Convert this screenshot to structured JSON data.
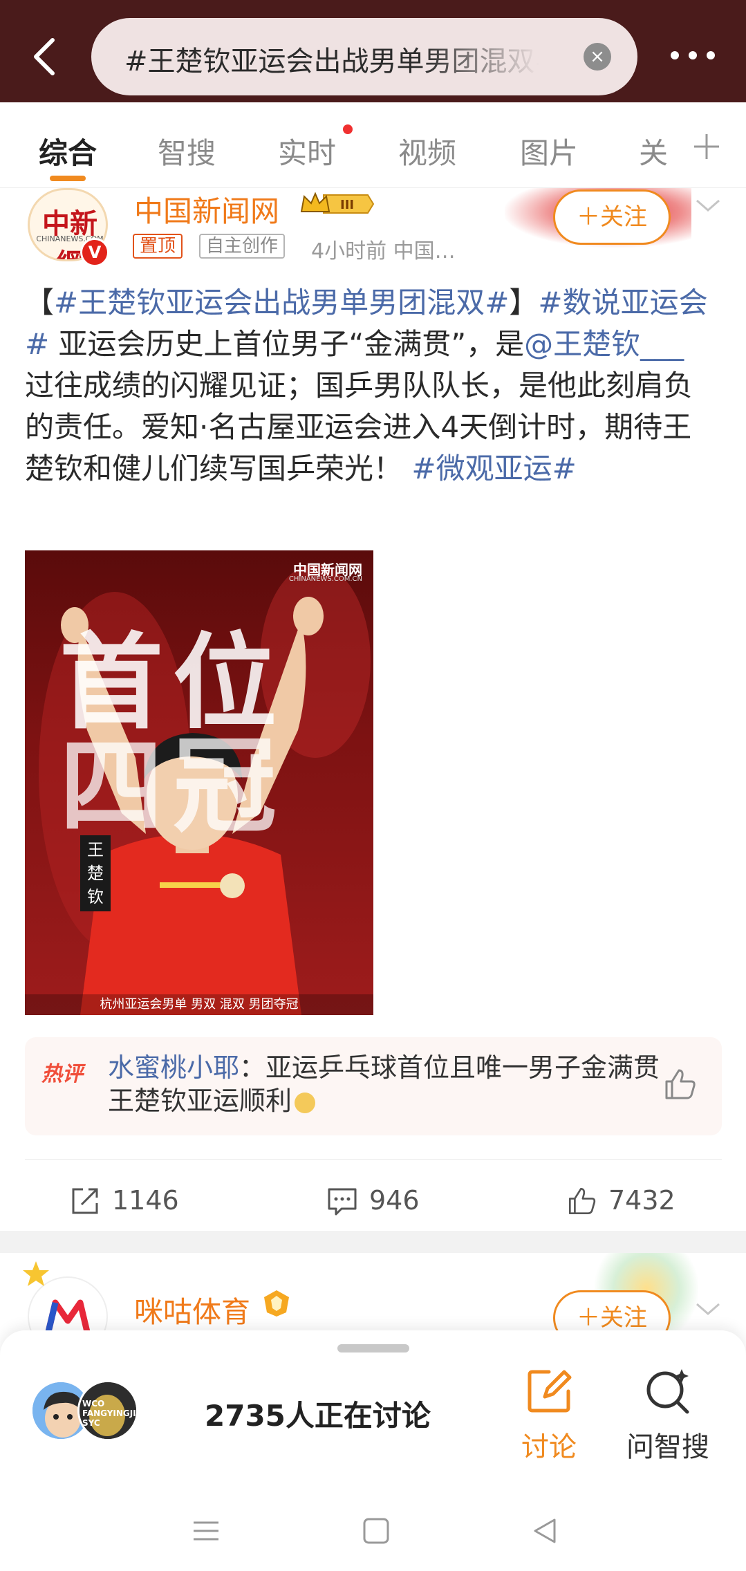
{
  "header": {
    "search_query": "#王楚钦亚运会出战男单男团混双#",
    "clear_symbol": "×"
  },
  "tabs": [
    {
      "label": "综合",
      "active": true
    },
    {
      "label": "智搜"
    },
    {
      "label": "实时",
      "has_dot": true
    },
    {
      "label": "视频"
    },
    {
      "label": "图片"
    },
    {
      "label": "关"
    }
  ],
  "post": {
    "avatar_logo": "中新網",
    "avatar_sub": "CHINANEWS.COM",
    "verified_badge": "V",
    "username": "中国新闻网",
    "level_badge": "III",
    "tag_pinned": "置顶",
    "tag_original": "自主创作",
    "meta": "4小时前  中国…",
    "follow_label": "＋关注",
    "text": {
      "p1_open": "【",
      "topic1": "#王楚钦亚运会出战男单男团混双#",
      "p1_close": "】",
      "topic2": "#数说亚运会#",
      "body1": " 亚运会历史上首位男子“金满贯”，是",
      "mention": "@王楚钦___",
      "body2": " 过往成绩的闪耀见证；国乒男队队长，是他此刻肩负的责任。爱知·名古屋亚运会进入4天倒计时，期待王楚钦和健儿们续写国乒荣光！",
      "topic3": "#微观亚运#"
    },
    "image": {
      "brand": "中国新闻网",
      "brand_sub": "CHINANEWS.COM.CN",
      "headline_line1": "首位",
      "headline_line2": "四冠",
      "player_name": "王楚钦",
      "caption": "杭州亚运会男单  男双  混双  男团夺冠"
    },
    "hot_comment": {
      "label": "热评",
      "user": "水蜜桃小耶",
      "sep": "：",
      "text": "亚运乒乓球首位且唯一男子金满贯王楚钦亚运顺利"
    },
    "actions": {
      "reposts": "1146",
      "comments": "946",
      "likes": "7432"
    }
  },
  "post2": {
    "username": "咪咕体育",
    "follow_label": "＋关注"
  },
  "bottom_sheet": {
    "avatar2_text": "WCO FANGYINGJI SYC",
    "discussing": "2735人正在讨论",
    "discuss_label": "讨论",
    "ask_label": "问智搜"
  },
  "colors": {
    "accent": "#f08a1f",
    "header_bg": "#4a1b1b",
    "link": "#4b6aa8"
  }
}
